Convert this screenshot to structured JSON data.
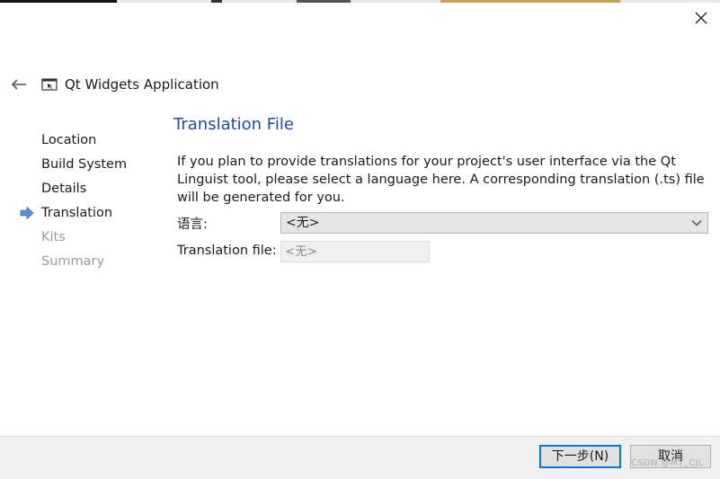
{
  "window": {
    "app_title": "Qt Widgets Application",
    "close_icon": "close-icon",
    "back_icon": "arrow-left-icon"
  },
  "steps": {
    "items": [
      {
        "label": "Location",
        "state": "done"
      },
      {
        "label": "Build System",
        "state": "done"
      },
      {
        "label": "Details",
        "state": "done"
      },
      {
        "label": "Translation",
        "state": "current"
      },
      {
        "label": "Kits",
        "state": "disabled"
      },
      {
        "label": "Summary",
        "state": "disabled"
      }
    ]
  },
  "page": {
    "title": "Translation File",
    "description": "If you plan to provide translations for your project's user interface via the Qt Linguist tool, please select a language here. A corresponding translation (.ts) file will be generated for you.",
    "language_label": "语言:",
    "language_value": "<无>",
    "translation_file_label": "Translation file:",
    "translation_file_value": "<无>"
  },
  "footer": {
    "next_label": "下一步(N)",
    "cancel_label": "取消"
  },
  "watermark": "CSDN @MY_CJL",
  "colors": {
    "accent": "#0078d7",
    "title": "#1e4b9c",
    "current_step_arrow": "#5b8fd6"
  }
}
